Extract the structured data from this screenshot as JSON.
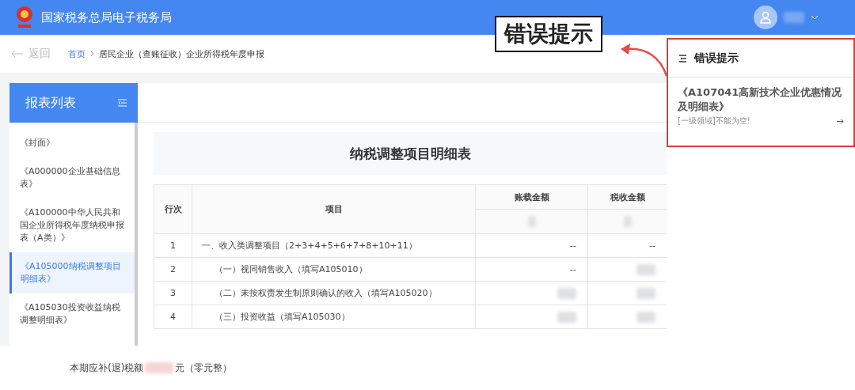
{
  "header": {
    "title": "国家税务总局电子税务局"
  },
  "nav": {
    "back": "返回",
    "breadcrumb": [
      {
        "label": "首页",
        "kind": "link"
      },
      {
        "label": "居民企业（查账征收）企业所得税年度申报",
        "kind": "current"
      }
    ]
  },
  "sidebar": {
    "title": "报表列表",
    "items": [
      {
        "label": "《封面》",
        "selected": false
      },
      {
        "label": "《A000000企业基础信息表》",
        "selected": false
      },
      {
        "label": "《A100000中华人民共和国企业所得税年度纳税申报表（A类）》",
        "selected": false
      },
      {
        "label": "《A105000纳税调整项目明细表》",
        "selected": true
      },
      {
        "label": "《A105030投资收益纳税调整明细表》",
        "selected": false
      }
    ]
  },
  "form": {
    "title": "纳税调整项目明细表",
    "columns": [
      "行次",
      "项目",
      "账载金额",
      "税收金额"
    ],
    "rows": [
      {
        "no": "1",
        "item": "一、收入类调整项目（2+3+4+5+6+7+8+10+11）",
        "indent": false,
        "values": [
          {
            "kind": "text",
            "text": "--"
          },
          {
            "kind": "text",
            "text": "--"
          }
        ]
      },
      {
        "no": "2",
        "item": "（一）视同销售收入（填写A105010）",
        "indent": true,
        "values": [
          {
            "kind": "text",
            "text": "--"
          },
          {
            "kind": "blurred"
          }
        ]
      },
      {
        "no": "3",
        "item": "（二）未按权责发生制原则确认的收入（填写A105020）",
        "indent": true,
        "values": [
          {
            "kind": "blurred"
          },
          {
            "kind": "blurred"
          }
        ]
      },
      {
        "no": "4",
        "item": "（三）投资收益（填写A105030）",
        "indent": true,
        "values": [
          {
            "kind": "blurred"
          },
          {
            "kind": "blurred"
          }
        ]
      }
    ]
  },
  "footer": {
    "label": "本期应补(退)税额",
    "unit": "元（零元整）"
  },
  "error_panel": {
    "title": "错误提示",
    "items": [
      {
        "form": "《A107041高新技术企业优惠情况及明细表》",
        "message": "[一级领域]不能为空!"
      }
    ]
  },
  "annotation": {
    "text": "错误提示"
  }
}
